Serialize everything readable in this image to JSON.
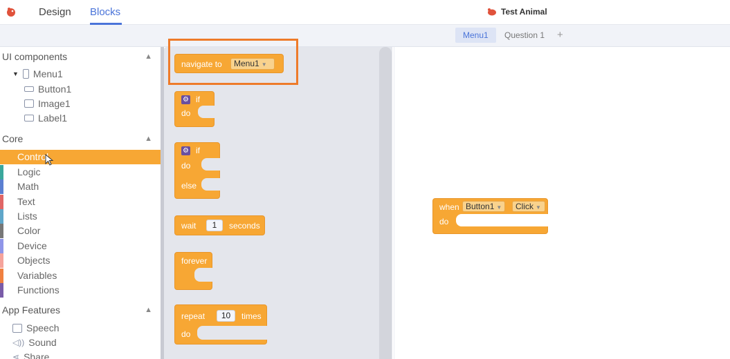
{
  "topbar": {
    "design_tab": "Design",
    "blocks_tab": "Blocks",
    "project_name": "Test Animal",
    "accent": "#4a74d9"
  },
  "screens": {
    "tabs": [
      "Menu1",
      "Question 1"
    ],
    "add": "+"
  },
  "palette": {
    "ui_components": {
      "title": "UI components",
      "screen": "Menu1",
      "items": [
        "Button1",
        "Image1",
        "Label1"
      ]
    },
    "core": {
      "title": "Core",
      "categories": [
        {
          "label": "Control",
          "color": "#f7a734"
        },
        {
          "label": "Logic",
          "color": "#3aa79c"
        },
        {
          "label": "Math",
          "color": "#5b7fd1"
        },
        {
          "label": "Text",
          "color": "#e06666"
        },
        {
          "label": "Lists",
          "color": "#5fa6c9"
        },
        {
          "label": "Color",
          "color": "#777777"
        },
        {
          "label": "Device",
          "color": "#8f95e8"
        },
        {
          "label": "Objects",
          "color": "#f5a39b"
        },
        {
          "label": "Variables",
          "color": "#f08040"
        },
        {
          "label": "Functions",
          "color": "#7a5ca8"
        }
      ]
    },
    "app_features": {
      "title": "App Features",
      "items": [
        "Speech",
        "Sound",
        "Share"
      ]
    }
  },
  "flyout": {
    "navigate": {
      "label": "navigate to",
      "value": "Menu1"
    },
    "if_block": {
      "if": "if",
      "do": "do"
    },
    "if_else_block": {
      "if": "if",
      "do": "do",
      "else": "else"
    },
    "wait_block": {
      "label": "wait",
      "value": "1",
      "suffix": "seconds"
    },
    "forever_block": {
      "label": "forever"
    },
    "repeat_block": {
      "label": "repeat",
      "value": "10",
      "suffix": "times",
      "do": "do"
    }
  },
  "workspace": {
    "event_block": {
      "when": "when",
      "component": "Button1",
      "event": "Click",
      "do": "do"
    }
  }
}
